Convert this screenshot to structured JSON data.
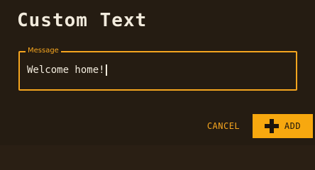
{
  "dialog": {
    "title": "Custom Text",
    "field": {
      "label": "Message",
      "value": "Welcome home!"
    },
    "actions": {
      "cancel_label": "CANCEL",
      "add_label": "ADD",
      "add_icon": "plus-icon"
    }
  },
  "colors": {
    "background": "#251c12",
    "accent": "#f5a51f",
    "text": "#f2ebdd"
  }
}
